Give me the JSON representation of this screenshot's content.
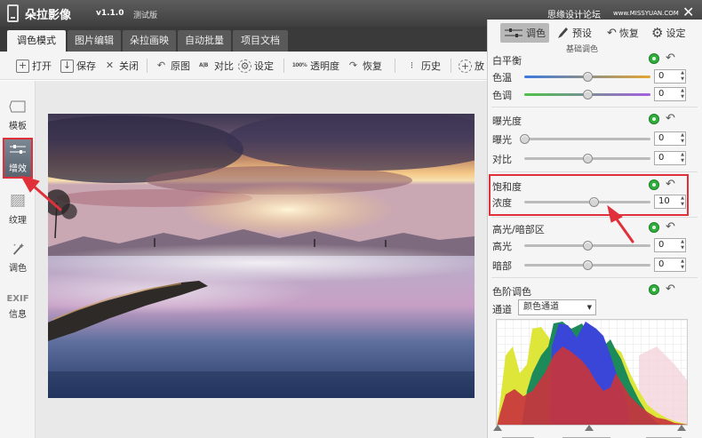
{
  "app": {
    "title": "朵拉影像",
    "version": "v1.1.0",
    "edition": "测试版",
    "watermark": "思缘设计论坛",
    "watermark_sub": "www.MISSYUAN.COM",
    "close": "✕"
  },
  "tabs": [
    {
      "label": "调色模式"
    },
    {
      "label": "图片编辑"
    },
    {
      "label": "朵拉画映"
    },
    {
      "label": "自动批量"
    },
    {
      "label": "项目文档"
    }
  ],
  "toolbar": {
    "open": "打开",
    "save": "保存",
    "close": "关闭",
    "original": "原图",
    "compare": "对比",
    "compare_icon": "A|B",
    "settings": "设定",
    "opacity": "透明度",
    "opacity_icon": "100%",
    "restore": "恢复",
    "history": "历史",
    "zoom": "放"
  },
  "leftbar": [
    {
      "label": "模板",
      "icon": "tag-icon"
    },
    {
      "label": "增效",
      "icon": "sliders-icon"
    },
    {
      "label": "纹理",
      "icon": "texture-icon"
    },
    {
      "label": "调色",
      "icon": "magic-wand-icon"
    },
    {
      "label": "信息",
      "icon": "exif-icon",
      "badge": "EXIF"
    }
  ],
  "right_panel": {
    "tabs": [
      {
        "label": "调色",
        "icon": "sliders-icon"
      },
      {
        "label": "预设",
        "icon": "brush-icon"
      },
      {
        "label": "恢复",
        "icon": "undo-icon"
      },
      {
        "label": "设定",
        "icon": "gear-icon"
      }
    ],
    "sub_caption": "基础调色",
    "white_balance": {
      "title": "白平衡",
      "rows": [
        {
          "label": "色温",
          "value": "0",
          "level": 0.5
        },
        {
          "label": "色调",
          "value": "0",
          "level": 0.5
        }
      ]
    },
    "exposure": {
      "title": "曝光度",
      "rows": [
        {
          "label": "曝光",
          "value": "0",
          "level": 0.0
        },
        {
          "label": "对比",
          "value": "0",
          "level": 0.5
        }
      ]
    },
    "saturation": {
      "title": "饱和度",
      "rows": [
        {
          "label": "浓度",
          "value": "10",
          "level": 0.55
        }
      ]
    },
    "highlights_shadows": {
      "title": "高光/暗部区",
      "rows": [
        {
          "label": "高光",
          "value": "0",
          "level": 0.5
        },
        {
          "label": "暗部",
          "value": "0",
          "level": 0.5
        }
      ]
    },
    "levels": {
      "title": "色阶调色",
      "channel_label": "通道",
      "channel_value": "颜色通道",
      "black_point": "0",
      "gamma": "1",
      "white_point": "255"
    }
  },
  "colors": {
    "titlebar": "#4a4a4a",
    "highlight_red": "#e0303a",
    "toggle_green": "#2fae3d"
  }
}
